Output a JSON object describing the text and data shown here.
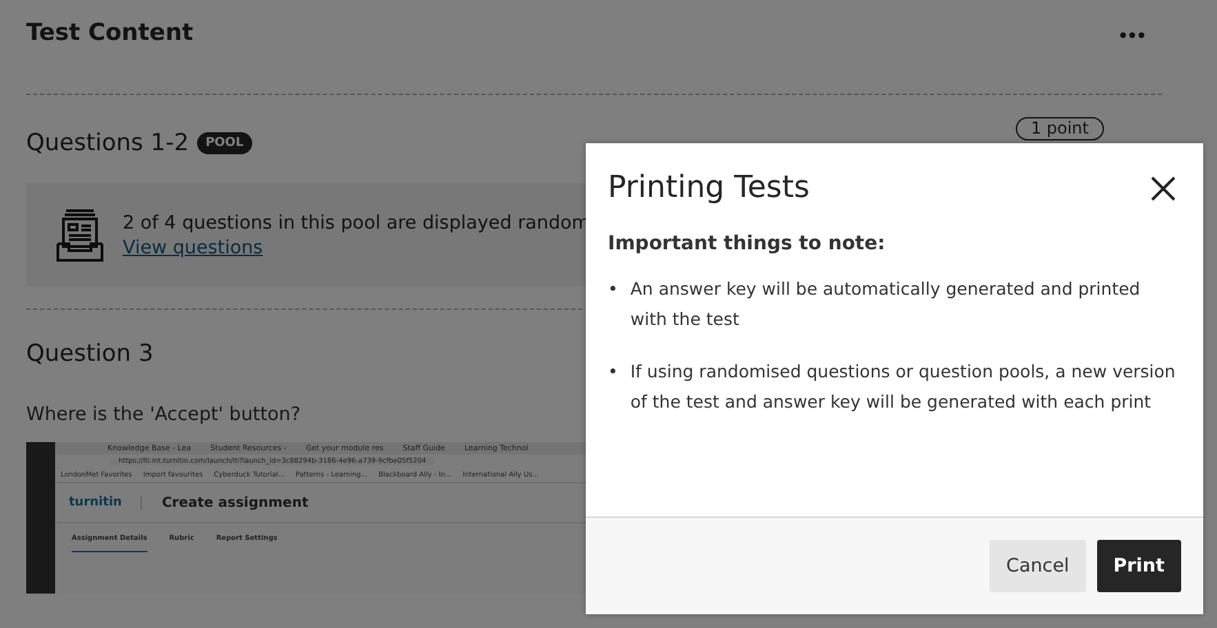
{
  "page": {
    "title": "Test Content",
    "more_label": "•••",
    "pool_section": {
      "title": "Questions 1-2",
      "badge": "POOL",
      "points": "1 point",
      "notice": "2 of 4 questions in this pool are displayed random",
      "link": "View questions"
    },
    "question": {
      "title": "Question 3",
      "prompt": "Where is the 'Accept' button?",
      "screenshot": {
        "tabs": [
          "Knowledge Base - Lea",
          "Student Resources - ",
          "Get your module res",
          "Staff Guide",
          "Learning Technol"
        ],
        "url": "https://lti.int.turnitin.com/launch/lti?launch_id=3c88294b-3186-4e96-a739-9cfbe05f5204",
        "bookmarks": [
          "LondonMet Favorites",
          "Import favourites",
          "Cyberduck Tutorial...",
          "Patterns - Learning...",
          "Blackboard Ally - In...",
          "International Ally Us..."
        ],
        "brand": "turnitin",
        "heading": "Create assignment",
        "nav": [
          {
            "label": "Assignment Details",
            "selected": true
          },
          {
            "label": "Rubric",
            "selected": false
          },
          {
            "label": "Report Settings",
            "selected": false
          }
        ]
      }
    }
  },
  "dialog": {
    "title": "Printing Tests",
    "subtitle": "Important things to note:",
    "notes": [
      {
        "marker": "•",
        "text": "An answer key will be automatically generated and printed with the test"
      },
      {
        "marker": "•",
        "text": "If using randomised questions or question pools, a new version of the test and answer key will be generated with each print"
      }
    ],
    "buttons": [
      {
        "label": "Cancel",
        "kind": "secondary"
      },
      {
        "label": "Print",
        "kind": "primary"
      }
    ]
  }
}
